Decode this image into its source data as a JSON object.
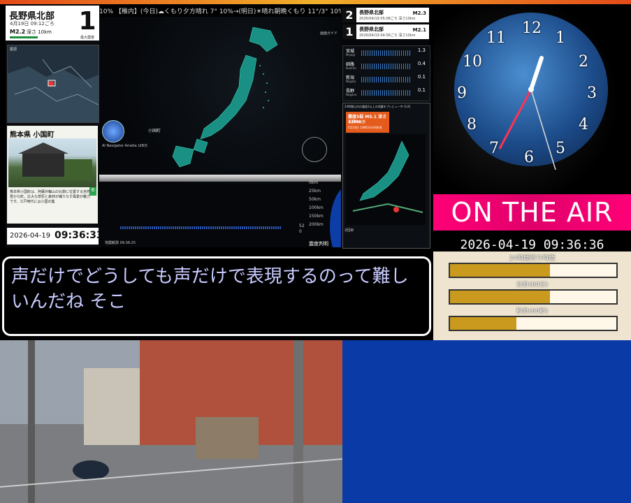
{
  "top_stripe_color": "#e9572a",
  "latest_quake": {
    "region": "長野県北部",
    "time": "4月19日 09:12ごろ",
    "magnitude": "M2.2",
    "depth": "深さ 10km",
    "intensity": "1",
    "intensity_label": "最大震度"
  },
  "mini_map": {
    "label": "震源"
  },
  "place": {
    "title": "熊本県 小国町",
    "description": "熊本県小国町は、阿蘇外輪山の北側に位置する自然豊かな町。広大な草原と森林が織りなす風景が魅力です。江戸時代には小国の集",
    "badge": "6"
  },
  "left_clock": {
    "date": "2026-04-19",
    "time": "09:36:33"
  },
  "ticker": "10% 【稚内】(今日)☁くもり夕方晴れ 7° 10%→(明日)☀晴れ朝晩くもり 11°/3° 10% 【旭川】(今日)☁く",
  "map": {
    "guide_label": "画面ガイド",
    "ai_navigator": "AI Navigator Amelia (dB)5",
    "city": "小国町",
    "depth_labels": [
      "0km",
      "25km",
      "50km",
      "100km",
      "150km",
      "200km"
    ],
    "observation_time": "地震観測 09:36:25",
    "shindo_button": "震度判明",
    "scale": [
      "52",
      "0"
    ]
  },
  "quake_list": [
    {
      "num": "2",
      "region": "長野県北部",
      "sub": "2026/04/19 05:08ごろ 深さ10km",
      "mag": "M2.3"
    },
    {
      "num": "1",
      "region": "長野県北部",
      "sub": "2026/04/19 04:56ごろ 深さ10km",
      "mag": "M2.1"
    }
  ],
  "seismograph": [
    {
      "name": "宮城",
      "sub": "Miyagi",
      "value": "1.3"
    },
    {
      "name": "釧路",
      "sub": "Kushiro",
      "value": "0.4"
    },
    {
      "name": "新潟",
      "sub": "Niigata",
      "value": "0.1"
    },
    {
      "name": "長野",
      "sub": "Nagano",
      "value": "0.1"
    }
  ],
  "preview": {
    "title": "24時間以内の震度1以上の地震をプレビュー中 (1/4)",
    "card_l1": "震度5弱 M5.1 深さ11km",
    "card_l2": "長野県北部",
    "card_l3": "4月18日 14時54分40秒頃",
    "label": "2回目"
  },
  "clock_digits": [
    "12",
    "1",
    "2",
    "3",
    "4",
    "5",
    "6",
    "7",
    "8",
    "9",
    "10",
    "11"
  ],
  "on_the_air": "ON THE AIR",
  "big_time": "2026-04-19 09:36:36",
  "progress": [
    {
      "label": "24時間残り時間",
      "value": 0.6
    },
    {
      "label": "分針(60分)",
      "value": 0.6
    },
    {
      "label": "秒針(60秒)",
      "value": 0.4
    }
  ],
  "subtitle": "声だけでどうしても声だけで表現するのって難しいんだね そこ",
  "colors": {
    "accent_pink": "#ff0077",
    "bar_fill": "#c99a1e",
    "blue_panel": "#0a3aa6",
    "subtitle_text": "#c8cbff"
  }
}
